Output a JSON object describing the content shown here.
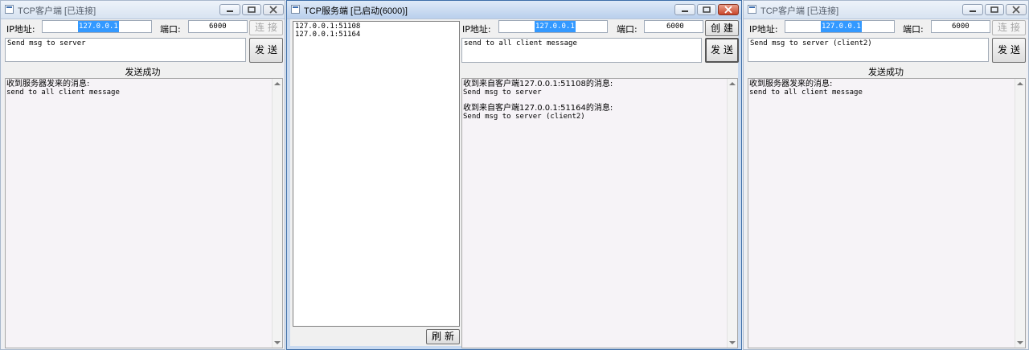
{
  "client_left": {
    "title": "TCP客户端 [已连接]",
    "ip_label": "IP地址:",
    "ip_value": "127.0.0.1",
    "port_label": "端口:",
    "port_value": "6000",
    "connect_label": "连接",
    "send_label": "发送",
    "message": "Send msg to server",
    "status": "发送成功",
    "log": [
      "收到服务器发来的消息:",
      "send to all client message"
    ]
  },
  "server": {
    "title": "TCP服务端 [已启动(6000)]",
    "clients": [
      "127.0.0.1:51108",
      "127.0.0.1:51164"
    ],
    "refresh_label": "刷新",
    "ip_label": "IP地址:",
    "ip_value": "127.0.0.1",
    "port_label": "端口:",
    "port_value": "6000",
    "create_label": "创建",
    "send_label": "发送",
    "message": "send to all client message",
    "log": [
      {
        "header": "收到来自客户端127.0.0.1:51108的消息:",
        "body": "Send msg to server"
      },
      {
        "header": "收到来自客户端127.0.0.1:51164的消息:",
        "body": "Send msg to server (client2)"
      }
    ]
  },
  "client_right": {
    "title": "TCP客户端 [已连接]",
    "ip_label": "IP地址:",
    "ip_value": "127.0.0.1",
    "port_label": "端口:",
    "port_value": "6000",
    "connect_label": "连接",
    "send_label": "发送",
    "message": "Send msg to server (client2)",
    "status": "发送成功",
    "log": [
      "收到服务器发来的消息:",
      "send to all client message"
    ]
  }
}
